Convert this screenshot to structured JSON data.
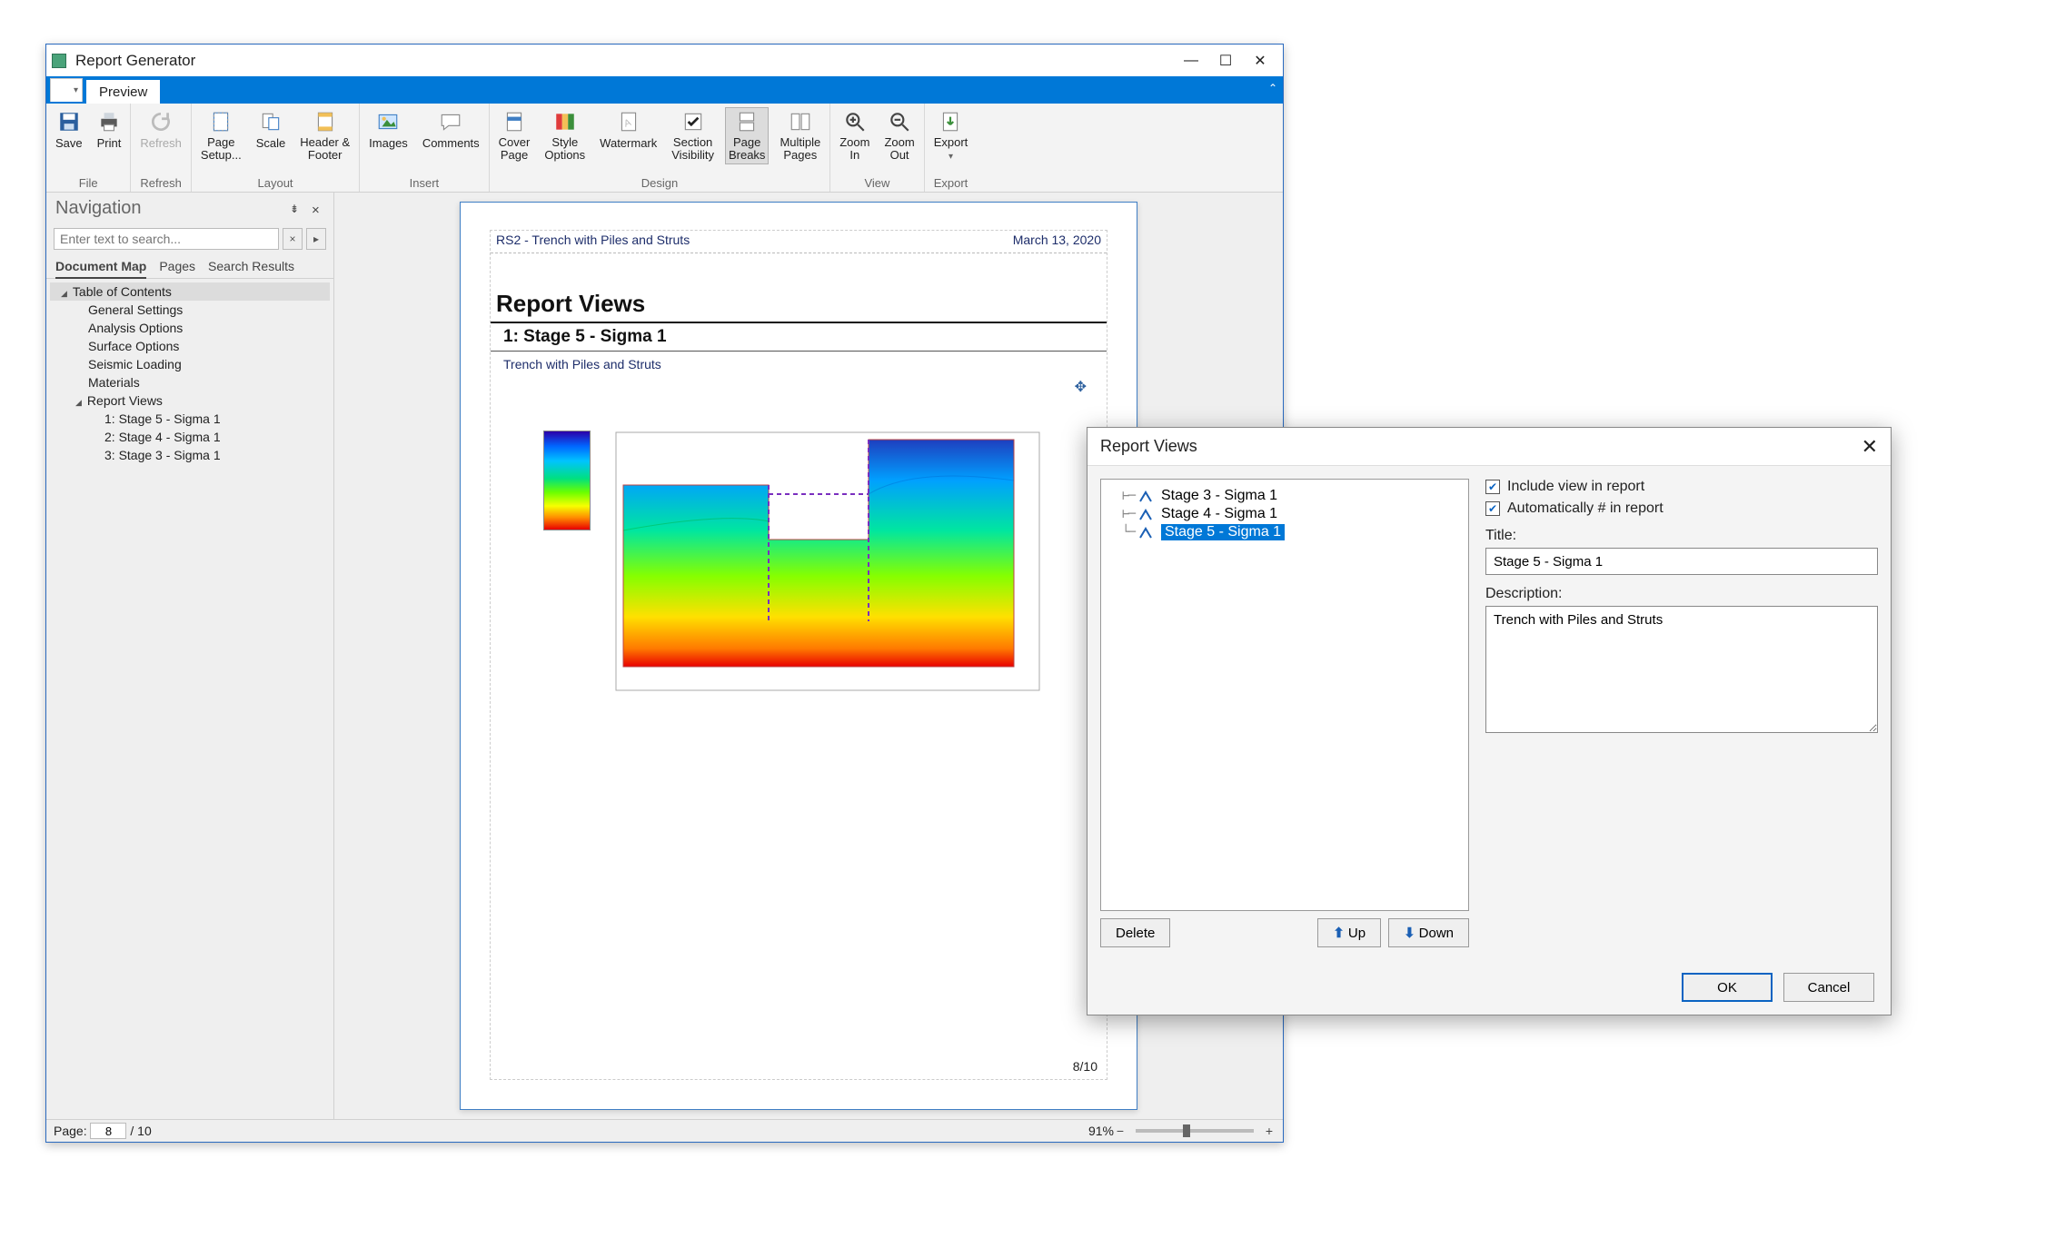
{
  "window": {
    "title": "Report Generator",
    "tabs": {
      "file_drop": "▾",
      "preview": "Preview"
    }
  },
  "ribbon": {
    "groups": {
      "file": {
        "label": "File",
        "save": "Save",
        "print": "Print"
      },
      "refresh": {
        "label": "Refresh",
        "refresh": "Refresh"
      },
      "layout": {
        "label": "Layout",
        "page_setup": "Page\nSetup...",
        "scale": "Scale",
        "header_footer": "Header &\nFooter"
      },
      "insert": {
        "label": "Insert",
        "images": "Images",
        "comments": "Comments"
      },
      "design": {
        "label": "Design",
        "cover_page": "Cover\nPage",
        "style_options": "Style\nOptions",
        "watermark": "Watermark",
        "section_visibility": "Section\nVisibility",
        "page_breaks": "Page\nBreaks",
        "multiple_pages": "Multiple\nPages"
      },
      "view": {
        "label": "View",
        "zoom_in": "Zoom\nIn",
        "zoom_out": "Zoom\nOut"
      },
      "export": {
        "label": "Export",
        "export": "Export"
      }
    }
  },
  "nav": {
    "title": "Navigation",
    "search_placeholder": "Enter text to search...",
    "tabs": {
      "doc_map": "Document Map",
      "pages": "Pages",
      "search": "Search Results"
    },
    "tree": {
      "root": "Table of Contents",
      "items": [
        "General Settings",
        "Analysis Options",
        "Surface Options",
        "Seismic Loading",
        "Materials"
      ],
      "report_views_node": "Report Views",
      "views": [
        "1: Stage 5 - Sigma 1",
        "2: Stage 4 - Sigma 1",
        "3: Stage 3 - Sigma 1"
      ]
    }
  },
  "page": {
    "project": "RS2 - Trench with Piles and Struts",
    "date": "March 13, 2020",
    "h1": "Report Views",
    "h2": "1: Stage 5 - Sigma 1",
    "sub": "Trench with Piles and Struts",
    "footer": "8/10"
  },
  "status": {
    "page_label": "Page:",
    "page_current": "8",
    "page_total": "/ 10",
    "zoom": "91%"
  },
  "dialog": {
    "title": "Report Views",
    "list": [
      "Stage 3 - Sigma 1",
      "Stage 4 - Sigma 1",
      "Stage 5 - Sigma 1"
    ],
    "selected_index": 2,
    "delete": "Delete",
    "up": "Up",
    "down": "Down",
    "include_label": "Include view in report",
    "autonum_label": "Automatically # in report",
    "title_label": "Title:",
    "title_value": "Stage 5 - Sigma 1",
    "desc_label": "Description:",
    "desc_value": "Trench with Piles and Struts",
    "ok": "OK",
    "cancel": "Cancel"
  }
}
